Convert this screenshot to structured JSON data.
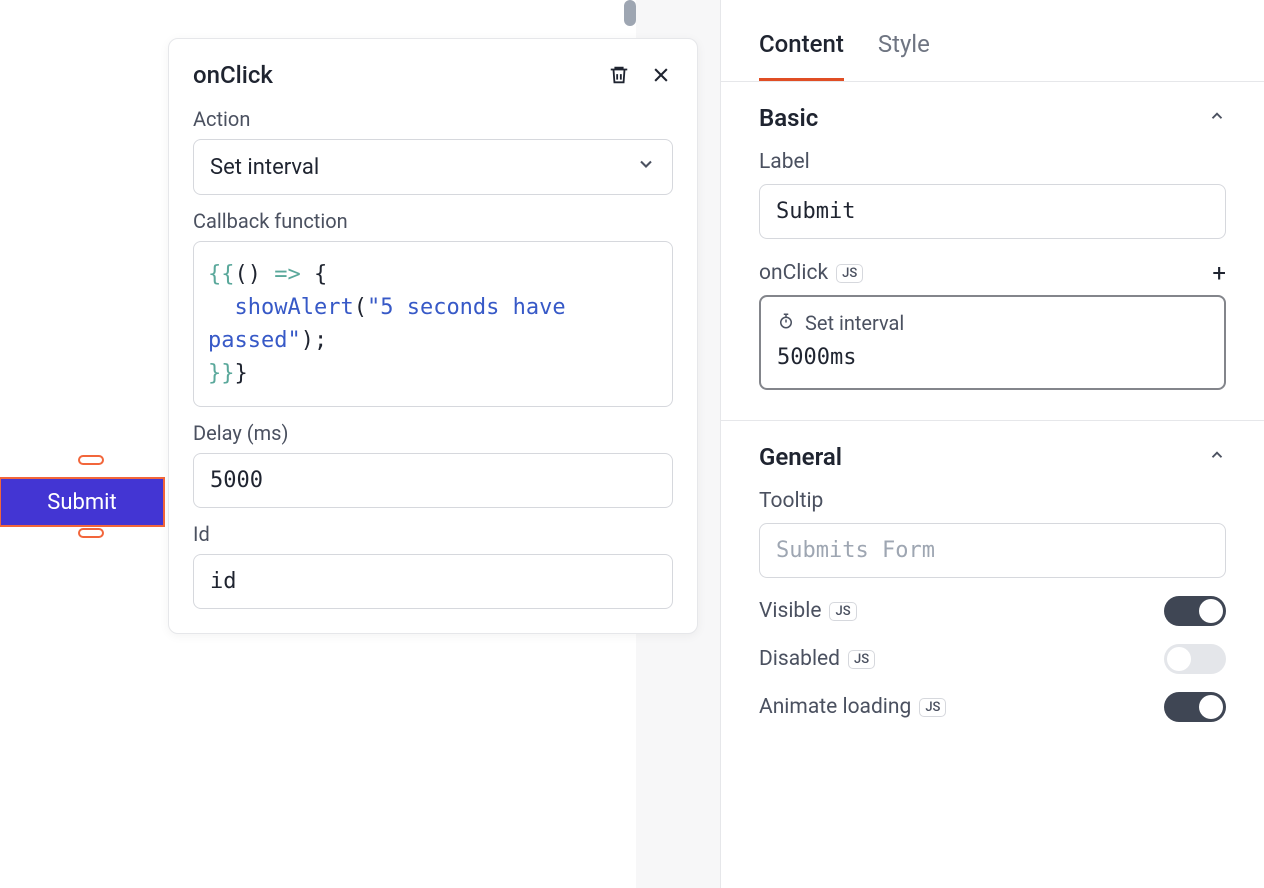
{
  "canvas": {
    "submit_button_label": "Submit"
  },
  "popover": {
    "title": "onClick",
    "action_label": "Action",
    "action_value": "Set interval",
    "callback_label": "Callback function",
    "callback_code": {
      "open_braces": "{{",
      "parens": "()",
      "arrow": "=>",
      "open_curly": "{",
      "fn_name": "showAlert",
      "open_paren": "(",
      "string": "\"5 seconds have passed\"",
      "close_call": ");",
      "close_braces": "}}",
      "last_curly": "}"
    },
    "delay_label": "Delay (ms)",
    "delay_value": "5000",
    "id_label": "Id",
    "id_value": "id"
  },
  "sidebar": {
    "tabs": {
      "content": "Content",
      "style": "Style"
    },
    "basic": {
      "title": "Basic",
      "label_label": "Label",
      "label_value": "Submit",
      "onclick_label": "onClick",
      "js_badge": "JS",
      "onclick_action": "Set interval",
      "onclick_value": "5000ms"
    },
    "general": {
      "title": "General",
      "tooltip_label": "Tooltip",
      "tooltip_placeholder": "Submits Form",
      "visible_label": "Visible",
      "disabled_label": "Disabled",
      "animate_label": "Animate loading",
      "visible_on": true,
      "disabled_on": false,
      "animate_on": true
    }
  }
}
